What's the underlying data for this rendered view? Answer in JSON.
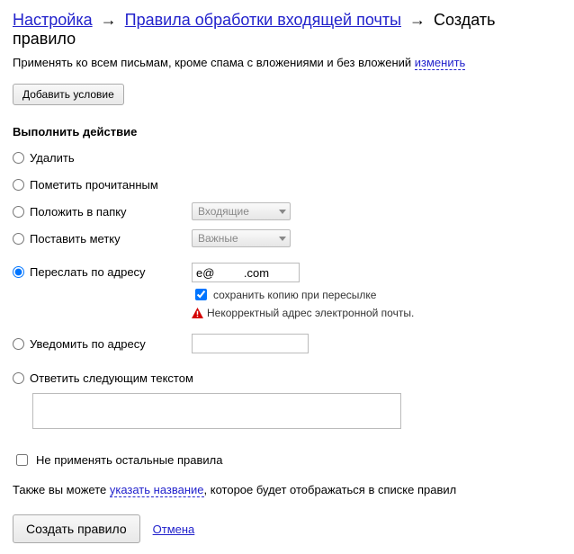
{
  "breadcrumb": {
    "settings": "Настройка",
    "rules": "Правила обработки входящей почты",
    "current": "Создать правило",
    "sep": "→"
  },
  "applies": {
    "text": "Применять ко всем письмам, кроме спама с вложениями и без вложений ",
    "change": "изменить"
  },
  "add_condition": "Добавить условие",
  "action_heading": "Выполнить действие",
  "actions": {
    "delete": "Удалить",
    "mark_read": "Пометить прочитанным",
    "move_to": "Положить в папку",
    "label": "Поставить метку",
    "forward": "Переслать по адресу",
    "notify": "Уведомить по адресу",
    "reply": "Ответить следующим текстом"
  },
  "selects": {
    "folder": "Входящие",
    "label": "Важные"
  },
  "forward": {
    "value": "e@         .com",
    "keep_copy": "сохранить копию при пересылке",
    "error": "Некорректный адрес электронной почты."
  },
  "notify_value": "",
  "reply_value": "",
  "dont_apply_others": "Не применять остальные правила",
  "also": {
    "before": "Также вы можете ",
    "link": "указать название",
    "after": ", которое будет отображаться в списке правил"
  },
  "footer": {
    "create": "Создать правило",
    "cancel": "Отмена"
  }
}
